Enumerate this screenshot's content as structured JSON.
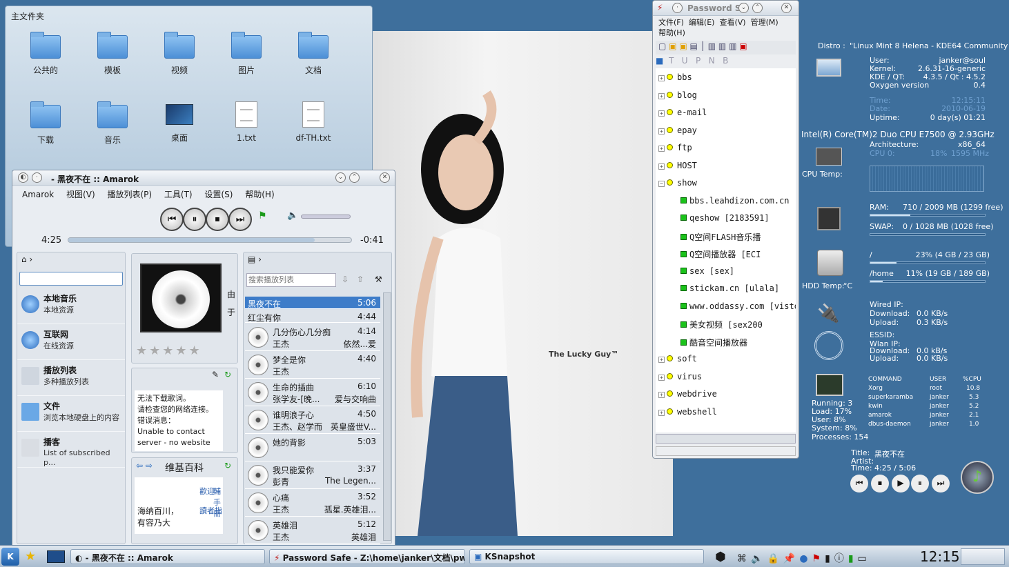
{
  "filemanager": {
    "title": "主文件夹",
    "icons": [
      "公共的",
      "模板",
      "视频",
      "图片",
      "文档",
      "下载",
      "音乐",
      "桌面",
      "1.txt",
      "df-TH.txt"
    ]
  },
  "photo": {
    "watermark": "The Lucky Guy™"
  },
  "amarok": {
    "title": "- 黑夜不在  ::  Amarok",
    "menu": [
      "Amarok",
      "视图(V)",
      "播放列表(P)",
      "工具(T)",
      "设置(S)",
      "帮助(H)"
    ],
    "elapsed": "4:25",
    "remaining": "-0:41",
    "progress": 0.87,
    "sources": [
      {
        "name": "本地音乐",
        "sub": "本地资源"
      },
      {
        "name": "互联网",
        "sub": "在线资源"
      },
      {
        "name": "播放列表",
        "sub": "多种播放列表"
      },
      {
        "name": "文件",
        "sub": "浏览本地硬盘上的内容"
      },
      {
        "name": "播客",
        "sub": "List of subscribed p..."
      }
    ],
    "context_side": [
      "由",
      "于"
    ],
    "lyrics": [
      "无法下载歌词。",
      "请检查您的网络连接。",
      "错误消息：",
      "Unable to contact",
      "server - no website"
    ],
    "wiki_title": "维基百科",
    "wiki_text": [
      "海纳百川，",
      "有容乃大"
    ],
    "wiki_side": [
      "歡迎",
      "讀者指",
      "輔手冊"
    ],
    "search_placeholder": "搜索播放列表",
    "playlist": [
      {
        "title": "黑夜不在",
        "len": "5:06",
        "artist": "",
        "album": ""
      },
      {
        "title": "红尘有你",
        "len": "4:44",
        "artist": "",
        "album": ""
      },
      {
        "title": "几分伤心几分痴",
        "len": "4:14",
        "artist": "王杰",
        "album": "依然...爱"
      },
      {
        "title": "梦全是你",
        "len": "4:40",
        "artist": "王杰",
        "album": ""
      },
      {
        "title": "生命的插曲",
        "len": "6:10",
        "artist": "张学友-[晚...",
        "album": "爱与交响曲"
      },
      {
        "title": "谁明浪子心",
        "len": "4:50",
        "artist": "王杰、赵学而",
        "album": "英皇盛世V..."
      },
      {
        "title": "她的背影",
        "len": "5:03",
        "artist": "",
        "album": ""
      },
      {
        "title": "我只能爱你",
        "len": "3:37",
        "artist": "彭青",
        "album": "The Legen..."
      },
      {
        "title": "心痛",
        "len": "3:52",
        "artist": "王杰",
        "album": "孤星.英雄泪..."
      },
      {
        "title": "英雄泪",
        "len": "5:12",
        "artist": "王杰",
        "album": "英雄泪"
      }
    ]
  },
  "pwsafe": {
    "title": "Password S",
    "menu": [
      "文件(F)",
      "编辑(E)",
      "查看(V)",
      "管理(M)",
      "帮助(H)"
    ],
    "toolbar2": [
      "T",
      "U",
      "P",
      "N",
      "B"
    ],
    "groups": [
      "bbs",
      "blog",
      "e-mail",
      "epay",
      "ftp",
      "HOST",
      "show"
    ],
    "show_items": [
      "bbs.leahdizon.com.cn [",
      "qeshow [2183591]",
      "Q空间FLASH音乐播",
      "Q空间播放器 [ECI",
      "sex [sex]",
      "stickam.cn [ulala]",
      "www.oddassy.com [visto",
      "美女视频 [sex200",
      "酷音空间播放器"
    ],
    "groups2": [
      "soft",
      "virus",
      "webdrive",
      "webshell"
    ]
  },
  "sysmon": {
    "distro_label": "Distro :",
    "distro": "\"Linux Mint 8 Helena - KDE64 Community Ed",
    "user_label": "User:",
    "user": "janker@soul",
    "kernel_label": "Kernel:",
    "kernel": "2.6.31-16-generic",
    "kde_label": "KDE / QT:",
    "kde": "4.3.5 / Qt : 4.5.2",
    "oxygen_label": "Oxygen version",
    "oxygen": "0.4",
    "time_label": "Time:",
    "time": "12:15:11",
    "date_label": "Date:",
    "date": "2010-06-19",
    "uptime_label": "Uptime:",
    "uptime": "0 day(s)  01:21",
    "cpu_name": "Intel(R) Core(TM)2 Duo CPU      E7500  @ 2.93GHz",
    "arch_label": "Architecture:",
    "arch": "x86_64",
    "cpu0_label": "CPU 0:",
    "cpu0": "18%",
    "cpu0_mhz": "1595 MHz",
    "cpu_temp": "CPU Temp:",
    "ram_label": "RAM:",
    "ram": "710 / 2009 MB (1299 free)",
    "ram_frac": 0.35,
    "swap_label": "SWAP:",
    "swap": "0 / 1028 MB (1028 free)",
    "swap_frac": 0.0,
    "root_label": "/",
    "root": "23% (4 GB / 23 GB)",
    "root_frac": 0.23,
    "home_label": "/home",
    "home": "11% (19 GB / 189 GB)",
    "home_frac": 0.11,
    "hdd_temp": "HDD Temp:",
    "hdd_unit": "°C",
    "wired_label": "Wired IP:",
    "dl_label": "Download:",
    "dl": "0.0 KB/s",
    "ul_label": "Upload:",
    "ul": "0.3 KB/s",
    "essid_label": "ESSID:",
    "wlan_label": "Wlan IP:",
    "wdl": "0.0 kB/s",
    "wul": "0.0 KB/s",
    "proc_headers": [
      "COMMAND",
      "USER",
      "%CPU"
    ],
    "procs": [
      [
        "Xorg",
        "root",
        "10.8"
      ],
      [
        "superkaramba",
        "janker",
        "5.3"
      ],
      [
        "kwin",
        "janker",
        "5.2"
      ],
      [
        "amarok",
        "janker",
        "2.1"
      ],
      [
        "dbus-daemon",
        "janker",
        "1.0"
      ]
    ],
    "stats": [
      "Running: 3",
      "Load:   17%",
      "User:    8%",
      "System:  8%",
      "Processes: 154"
    ],
    "np_title_label": "Title:",
    "np_title": "黑夜不在",
    "np_artist_label": "Artist:",
    "np_time_label": "Time:",
    "np_time": "4:25 / 5:06"
  },
  "taskbar": {
    "tasks": [
      "- 黑夜不在  ::  Amarok",
      "Password Safe - Z:\\home\\janker\\文档\\pwdkee",
      "KSnapshot"
    ],
    "clock": "12:15"
  }
}
